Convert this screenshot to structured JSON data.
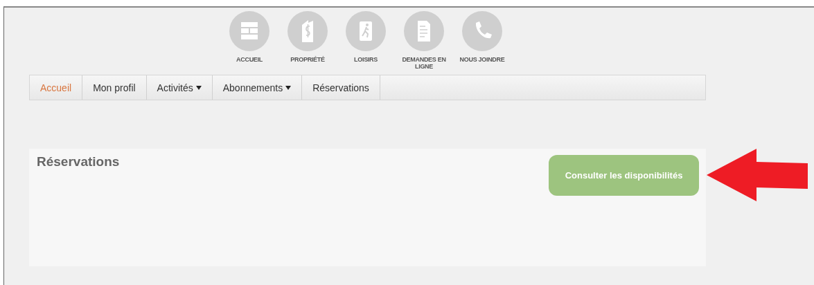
{
  "top_menu": [
    {
      "label": "ACCUEIL"
    },
    {
      "label": "PROPRIÉTÉ"
    },
    {
      "label": "LOISIRS"
    },
    {
      "label": "DEMANDES EN LIGNE"
    },
    {
      "label": "NOUS JOINDRE"
    }
  ],
  "nav": [
    {
      "label": "Accueil",
      "selected": true,
      "dropdown": false
    },
    {
      "label": "Mon profil",
      "selected": false,
      "dropdown": false
    },
    {
      "label": "Activités",
      "selected": false,
      "dropdown": true
    },
    {
      "label": "Abonnements",
      "selected": false,
      "dropdown": true
    },
    {
      "label": "Réservations",
      "selected": false,
      "dropdown": false
    }
  ],
  "panel": {
    "title": "Réservations",
    "button": "Consulter les disponibilités"
  }
}
